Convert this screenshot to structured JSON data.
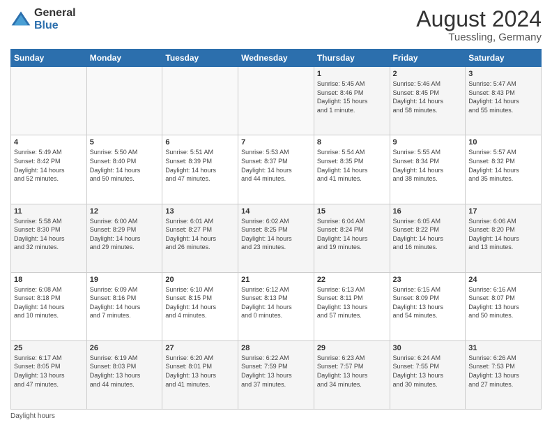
{
  "logo": {
    "general": "General",
    "blue": "Blue"
  },
  "header": {
    "month_year": "August 2024",
    "location": "Tuessling, Germany"
  },
  "days_of_week": [
    "Sunday",
    "Monday",
    "Tuesday",
    "Wednesday",
    "Thursday",
    "Friday",
    "Saturday"
  ],
  "footer": {
    "note": "Daylight hours"
  },
  "weeks": [
    [
      {
        "day": "",
        "info": ""
      },
      {
        "day": "",
        "info": ""
      },
      {
        "day": "",
        "info": ""
      },
      {
        "day": "",
        "info": ""
      },
      {
        "day": "1",
        "info": "Sunrise: 5:45 AM\nSunset: 8:46 PM\nDaylight: 15 hours\nand 1 minute."
      },
      {
        "day": "2",
        "info": "Sunrise: 5:46 AM\nSunset: 8:45 PM\nDaylight: 14 hours\nand 58 minutes."
      },
      {
        "day": "3",
        "info": "Sunrise: 5:47 AM\nSunset: 8:43 PM\nDaylight: 14 hours\nand 55 minutes."
      }
    ],
    [
      {
        "day": "4",
        "info": "Sunrise: 5:49 AM\nSunset: 8:42 PM\nDaylight: 14 hours\nand 52 minutes."
      },
      {
        "day": "5",
        "info": "Sunrise: 5:50 AM\nSunset: 8:40 PM\nDaylight: 14 hours\nand 50 minutes."
      },
      {
        "day": "6",
        "info": "Sunrise: 5:51 AM\nSunset: 8:39 PM\nDaylight: 14 hours\nand 47 minutes."
      },
      {
        "day": "7",
        "info": "Sunrise: 5:53 AM\nSunset: 8:37 PM\nDaylight: 14 hours\nand 44 minutes."
      },
      {
        "day": "8",
        "info": "Sunrise: 5:54 AM\nSunset: 8:35 PM\nDaylight: 14 hours\nand 41 minutes."
      },
      {
        "day": "9",
        "info": "Sunrise: 5:55 AM\nSunset: 8:34 PM\nDaylight: 14 hours\nand 38 minutes."
      },
      {
        "day": "10",
        "info": "Sunrise: 5:57 AM\nSunset: 8:32 PM\nDaylight: 14 hours\nand 35 minutes."
      }
    ],
    [
      {
        "day": "11",
        "info": "Sunrise: 5:58 AM\nSunset: 8:30 PM\nDaylight: 14 hours\nand 32 minutes."
      },
      {
        "day": "12",
        "info": "Sunrise: 6:00 AM\nSunset: 8:29 PM\nDaylight: 14 hours\nand 29 minutes."
      },
      {
        "day": "13",
        "info": "Sunrise: 6:01 AM\nSunset: 8:27 PM\nDaylight: 14 hours\nand 26 minutes."
      },
      {
        "day": "14",
        "info": "Sunrise: 6:02 AM\nSunset: 8:25 PM\nDaylight: 14 hours\nand 23 minutes."
      },
      {
        "day": "15",
        "info": "Sunrise: 6:04 AM\nSunset: 8:24 PM\nDaylight: 14 hours\nand 19 minutes."
      },
      {
        "day": "16",
        "info": "Sunrise: 6:05 AM\nSunset: 8:22 PM\nDaylight: 14 hours\nand 16 minutes."
      },
      {
        "day": "17",
        "info": "Sunrise: 6:06 AM\nSunset: 8:20 PM\nDaylight: 14 hours\nand 13 minutes."
      }
    ],
    [
      {
        "day": "18",
        "info": "Sunrise: 6:08 AM\nSunset: 8:18 PM\nDaylight: 14 hours\nand 10 minutes."
      },
      {
        "day": "19",
        "info": "Sunrise: 6:09 AM\nSunset: 8:16 PM\nDaylight: 14 hours\nand 7 minutes."
      },
      {
        "day": "20",
        "info": "Sunrise: 6:10 AM\nSunset: 8:15 PM\nDaylight: 14 hours\nand 4 minutes."
      },
      {
        "day": "21",
        "info": "Sunrise: 6:12 AM\nSunset: 8:13 PM\nDaylight: 14 hours\nand 0 minutes."
      },
      {
        "day": "22",
        "info": "Sunrise: 6:13 AM\nSunset: 8:11 PM\nDaylight: 13 hours\nand 57 minutes."
      },
      {
        "day": "23",
        "info": "Sunrise: 6:15 AM\nSunset: 8:09 PM\nDaylight: 13 hours\nand 54 minutes."
      },
      {
        "day": "24",
        "info": "Sunrise: 6:16 AM\nSunset: 8:07 PM\nDaylight: 13 hours\nand 50 minutes."
      }
    ],
    [
      {
        "day": "25",
        "info": "Sunrise: 6:17 AM\nSunset: 8:05 PM\nDaylight: 13 hours\nand 47 minutes."
      },
      {
        "day": "26",
        "info": "Sunrise: 6:19 AM\nSunset: 8:03 PM\nDaylight: 13 hours\nand 44 minutes."
      },
      {
        "day": "27",
        "info": "Sunrise: 6:20 AM\nSunset: 8:01 PM\nDaylight: 13 hours\nand 41 minutes."
      },
      {
        "day": "28",
        "info": "Sunrise: 6:22 AM\nSunset: 7:59 PM\nDaylight: 13 hours\nand 37 minutes."
      },
      {
        "day": "29",
        "info": "Sunrise: 6:23 AM\nSunset: 7:57 PM\nDaylight: 13 hours\nand 34 minutes."
      },
      {
        "day": "30",
        "info": "Sunrise: 6:24 AM\nSunset: 7:55 PM\nDaylight: 13 hours\nand 30 minutes."
      },
      {
        "day": "31",
        "info": "Sunrise: 6:26 AM\nSunset: 7:53 PM\nDaylight: 13 hours\nand 27 minutes."
      }
    ]
  ]
}
